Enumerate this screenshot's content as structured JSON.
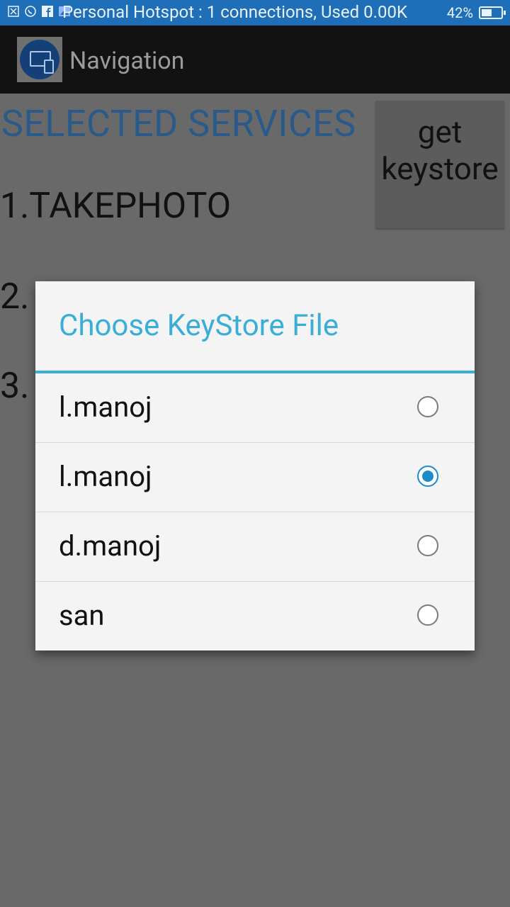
{
  "status_bar": {
    "text": "Personal Hotspot : 1 connections, Used 0.00K",
    "battery": "42%",
    "icons": [
      "close-box-icon",
      "whatsapp-icon",
      "facebook-icon",
      "image-icon"
    ]
  },
  "app_bar": {
    "title": "Navigation"
  },
  "content": {
    "heading": "SELECTED SERVICES",
    "services": [
      "1.TAKEPHOTO",
      "2.",
      "3."
    ],
    "get_button_label": "get keystore"
  },
  "dialog": {
    "title": "Choose KeyStore File",
    "options": [
      {
        "label": "l.manoj",
        "checked": false
      },
      {
        "label": "l.manoj",
        "checked": true
      },
      {
        "label": "d.manoj",
        "checked": false
      },
      {
        "label": "san",
        "checked": false
      }
    ],
    "accent_color": "#3aaed8"
  }
}
